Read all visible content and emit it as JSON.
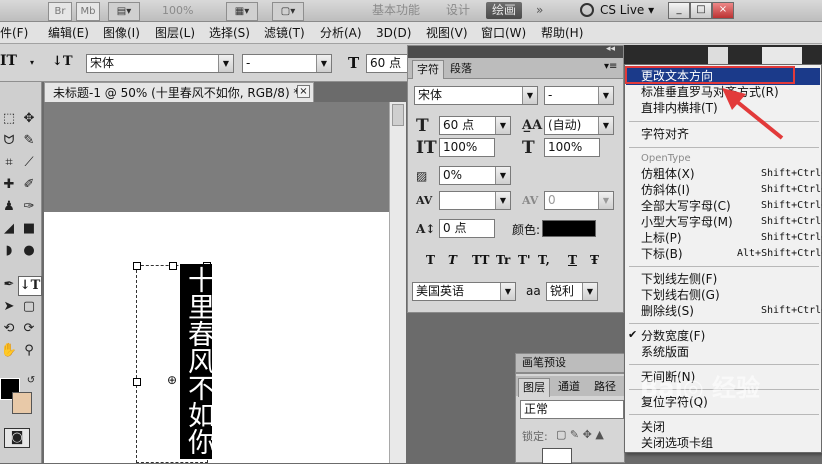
{
  "appbar": {
    "mini_labels": [
      "Br",
      "Mb"
    ],
    "zoom": "100%",
    "workspaces": [
      "基本功能",
      "设计",
      "绘画"
    ],
    "active_workspace": "绘画",
    "more": "»",
    "cslive": "CS Live",
    "win_buttons": [
      "_",
      "□",
      "×"
    ]
  },
  "menubar": {
    "items": [
      "文件(F)",
      "编辑(E)",
      "图像(I)",
      "图层(L)",
      "选择(S)",
      "滤镜(T)",
      "分析(A)",
      "3D(D)",
      "视图(V)",
      "窗口(W)",
      "帮助(H)"
    ]
  },
  "options": {
    "tool_glyph": "IT",
    "font_family": "宋体",
    "font_style": "-",
    "font_size": "60 点"
  },
  "document": {
    "tab_title": "未标题-1 @ 50% (十里春风不如你, RGB/8) *",
    "close": "×",
    "vertical_text": "十里春风不如你"
  },
  "char_panel": {
    "tabs": [
      "字符",
      "段落"
    ],
    "font_family": "宋体",
    "font_style": "-",
    "font_size": "60 点",
    "leading": "(自动)",
    "vscale": "100%",
    "hscale": "100%",
    "tsume": "0%",
    "kerning": "",
    "tracking": "0",
    "baseline": "0 点",
    "color_label": "颜色:",
    "color": "#000000",
    "format_buttons": [
      "T",
      "T",
      "TT",
      "Tr",
      "T'",
      "T,",
      "T",
      "Ŧ"
    ],
    "language": "美国英语",
    "aa_icon": "aa",
    "antialias": "锐利"
  },
  "lower_panels": {
    "brush_tab": "画笔预设",
    "layer_tabs": [
      "图层",
      "通道",
      "路径"
    ],
    "blend_mode": "正常",
    "lock_label": "锁定:"
  },
  "context_menu": {
    "items": [
      {
        "label": "更改文本方向",
        "highlighted": true
      },
      {
        "label": "标准垂直罗马对齐方式(R)"
      },
      {
        "label": "直排内横排(T)"
      },
      {
        "label": "字符对齐"
      },
      {
        "label": "OpenType",
        "disabled": true
      },
      {
        "label": "仿粗体(X)",
        "shortcut": "Shift+Ctrl+"
      },
      {
        "label": "仿斜体(I)",
        "shortcut": "Shift+Ctrl+"
      },
      {
        "label": "全部大写字母(C)",
        "shortcut": "Shift+Ctrl+"
      },
      {
        "label": "小型大写字母(M)",
        "shortcut": "Shift+Ctrl+"
      },
      {
        "label": "上标(P)",
        "shortcut": "Shift+Ctrl+"
      },
      {
        "label": "下标(B)",
        "shortcut": "Alt+Shift+Ctrl+"
      },
      {
        "label": "下划线左侧(F)"
      },
      {
        "label": "下划线右侧(G)"
      },
      {
        "label": "删除线(S)",
        "shortcut": "Shift+Ctrl+"
      },
      {
        "label": "分数宽度(F)",
        "checked": true
      },
      {
        "label": "系统版面"
      },
      {
        "label": "无间断(N)"
      },
      {
        "label": "复位字符(Q)"
      },
      {
        "label": "关闭"
      },
      {
        "label": "关闭选项卡组"
      }
    ]
  },
  "colors": {
    "menu_highlight": "#1b3a8a",
    "annotation_red": "#e23a3a",
    "foreground": "#000000",
    "background_swatch": "#e8c9a8"
  }
}
